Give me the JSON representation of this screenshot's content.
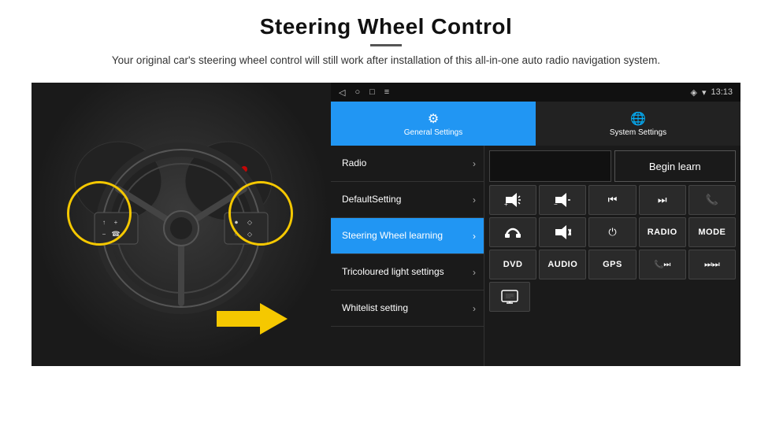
{
  "header": {
    "title": "Steering Wheel Control",
    "subtitle": "Your original car's steering wheel control will still work after installation of this all-in-one auto radio navigation system."
  },
  "android_ui": {
    "status_bar": {
      "time": "13:13",
      "icons": [
        "back",
        "home",
        "square",
        "menu"
      ]
    },
    "tabs": [
      {
        "label": "General Settings",
        "icon": "⚙",
        "active": true
      },
      {
        "label": "System Settings",
        "icon": "🌐",
        "active": false
      }
    ],
    "menu_items": [
      {
        "label": "Radio",
        "active": false
      },
      {
        "label": "DefaultSetting",
        "active": false
      },
      {
        "label": "Steering Wheel learning",
        "active": true
      },
      {
        "label": "Tricoloured light settings",
        "active": false
      },
      {
        "label": "Whitelist setting",
        "active": false
      }
    ],
    "controls": {
      "begin_learn": "Begin learn",
      "row1": [
        "🔊+",
        "🔊-",
        "⏮",
        "⏭",
        "📞"
      ],
      "row2": [
        "📞",
        "🔇",
        "⏻",
        "RADIO",
        "MODE"
      ],
      "row3": [
        "DVD",
        "AUDIO",
        "GPS",
        "📞⏭",
        "⏭⏭"
      ],
      "row4": [
        "🖥"
      ]
    }
  }
}
